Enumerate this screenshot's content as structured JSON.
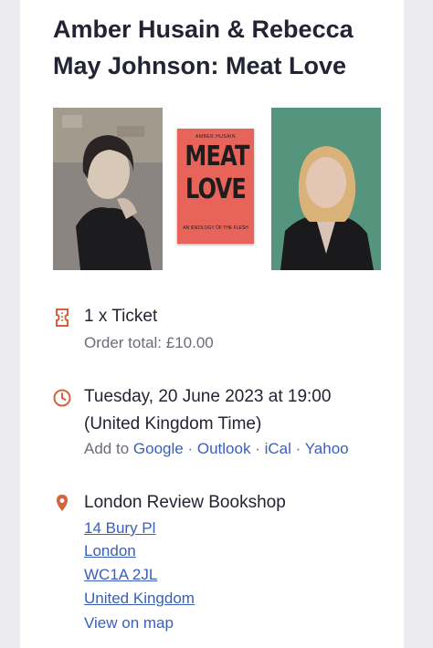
{
  "event": {
    "title": "Amber Husain & Rebecca May Johnson: Meat Love"
  },
  "book_cover": {
    "author": "AMBER HUSAIN",
    "title_line1": "MEAT",
    "title_line2": "LOVE",
    "subtitle": "AN IDEOLOGY OF THE FLESH",
    "color": "#e8645a"
  },
  "ticket": {
    "icon": "ticket-icon",
    "quantity_label": "1 x Ticket",
    "order_total": "Order total: £10.00"
  },
  "datetime": {
    "icon": "clock-icon",
    "date_line": "Tuesday, 20 June 2023 at 19:00",
    "timezone": "(United Kingdom Time)",
    "add_to_label": "Add to",
    "calendars": [
      "Google",
      "Outlook",
      "iCal",
      "Yahoo"
    ],
    "separator": "·"
  },
  "location": {
    "icon": "location-pin-icon",
    "venue": "London Review Bookshop",
    "address_lines": [
      "14 Bury Pl",
      "London",
      "WC1A 2JL",
      "United Kingdom"
    ],
    "map_link": "View on map"
  },
  "colors": {
    "accent_icon": "#d4623f",
    "link": "#3a5fb8",
    "text": "#222433",
    "muted": "#6a6d78"
  }
}
